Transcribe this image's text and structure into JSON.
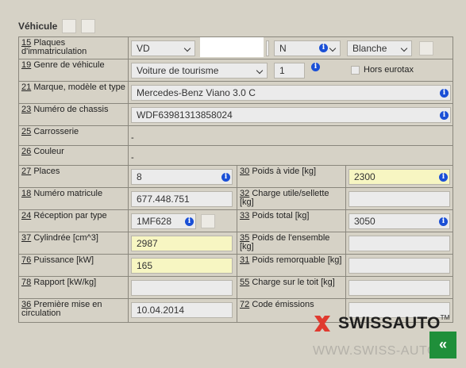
{
  "header": {
    "title": "Véhicule"
  },
  "rows": {
    "plates": {
      "num": "15",
      "label": "Plaques d'immatriculation",
      "canton": "VD",
      "number_value": "",
      "type": "N",
      "color": "Blanche"
    },
    "genre": {
      "num": "19",
      "label": "Genre de véhicule",
      "value": "Voiture de tourisme",
      "count": "1",
      "eurotax_label": "Hors eurotax"
    },
    "marque": {
      "num": "21",
      "label": "Marque, modèle et type",
      "value": "Mercedes-Benz Viano 3.0 C"
    },
    "chassis": {
      "num": "23",
      "label": "Numéro de chassis",
      "value": "WDF63981313858024"
    },
    "carrosserie": {
      "num": "25",
      "label": "Carrosserie",
      "value": "-"
    },
    "couleur": {
      "num": "26",
      "label": "Couleur",
      "value": "-"
    },
    "places": {
      "num": "27",
      "label": "Places",
      "value": "8"
    },
    "poids_vide": {
      "num": "30",
      "label": "Poids à vide [kg]",
      "value": "2300"
    },
    "matricule": {
      "num": "18",
      "label": "Numéro matricule",
      "value": "677.448.751"
    },
    "charge_utile": {
      "num": "32",
      "label": "Charge utile/sellette [kg]",
      "value": ""
    },
    "reception": {
      "num": "24",
      "label": "Réception par type",
      "value": "1MF628"
    },
    "poids_total": {
      "num": "33",
      "label": "Poids total [kg]",
      "value": "3050"
    },
    "cylindree": {
      "num": "37",
      "label": "Cylindrée [cm^3]",
      "value": "2987"
    },
    "poids_ensemble": {
      "num": "35",
      "label": "Poids de l'ensemble [kg]",
      "value": ""
    },
    "puissance": {
      "num": "76",
      "label": "Puissance [kW]",
      "value": "165"
    },
    "poids_remorquable": {
      "num": "31",
      "label": "Poids remorquable [kg]",
      "value": ""
    },
    "rapport": {
      "num": "78",
      "label": "Rapport [kW/kg]",
      "value": ""
    },
    "charge_toit": {
      "num": "55",
      "label": "Charge sur le toit [kg]",
      "value": ""
    },
    "premiere_mise": {
      "num": "36",
      "label": "Première mise en circulation",
      "value": "10.04.2014"
    },
    "code_emissions": {
      "num": "72",
      "label": "Code émissions",
      "value": ""
    }
  },
  "watermark": {
    "brand": "SWISSAUTO",
    "tm": "TM",
    "url": "WWW.SWISS-AUTO.C"
  },
  "back_button": {
    "label": "«"
  },
  "colors": {
    "background": "#d6d2c6",
    "highlight": "#f7f6c2",
    "info": "#1a4fd6",
    "logo_red": "#e03a2f",
    "button_green": "#1f8f3a"
  }
}
